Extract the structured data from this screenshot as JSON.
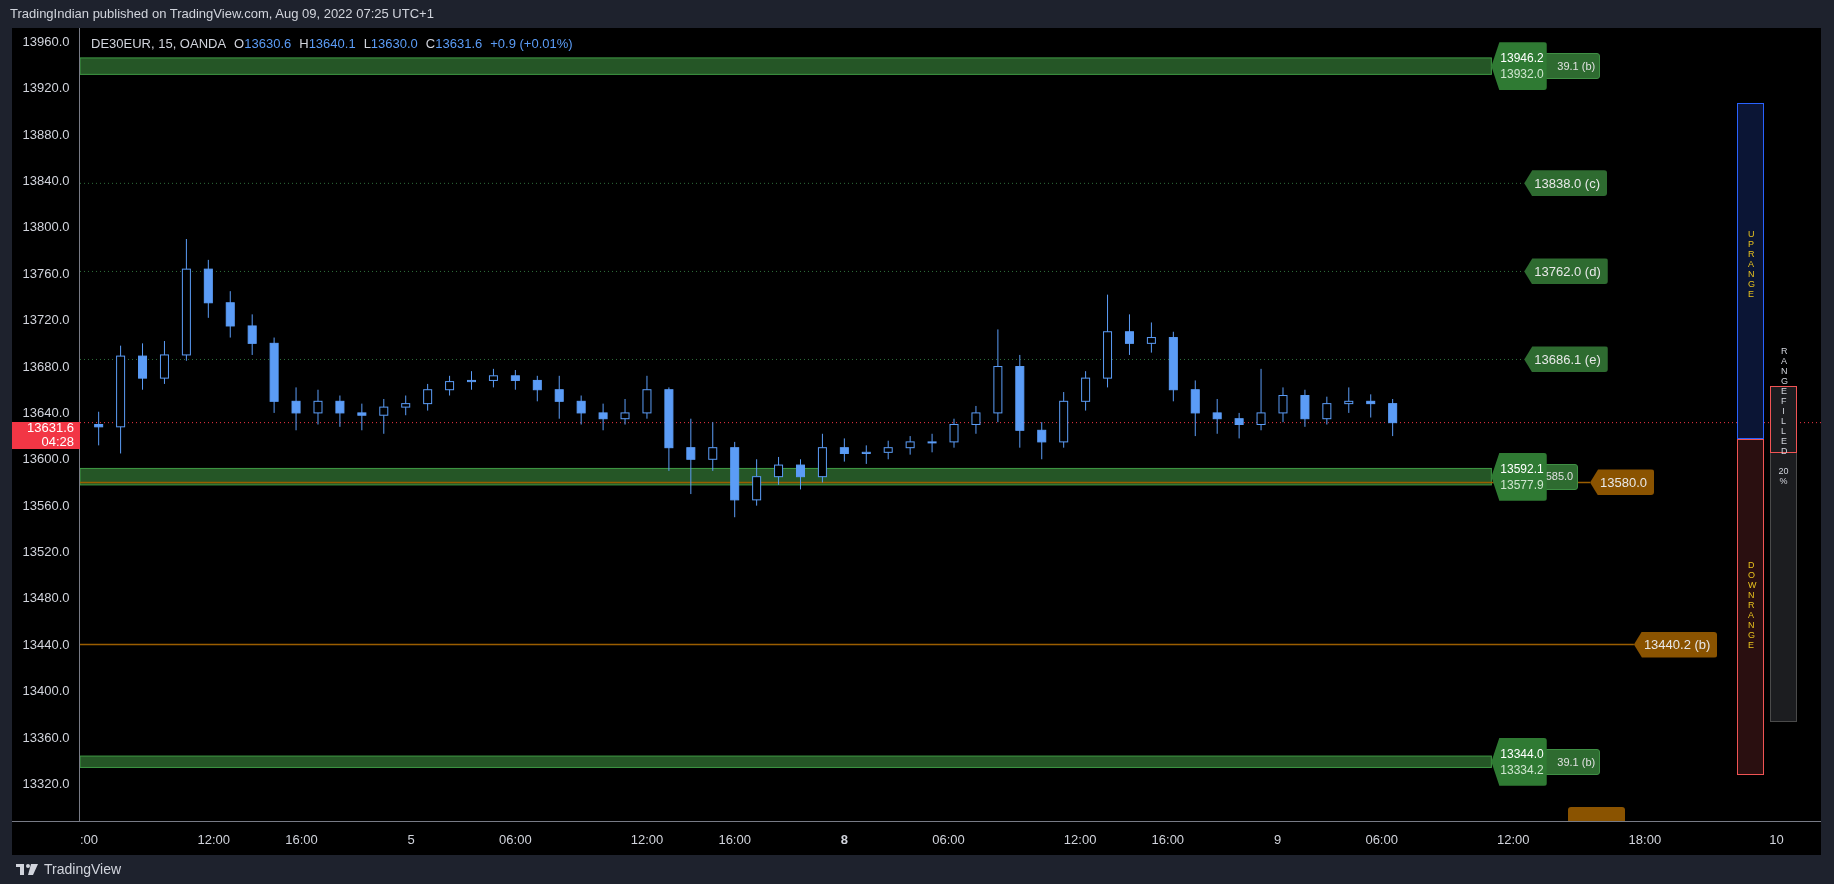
{
  "header": {
    "text": "TradingIndian published on TradingView.com, Aug 09, 2022 07:25 UTC+1"
  },
  "legend": {
    "symbol": "DE30EUR, 15, OANDA",
    "fields": [
      {
        "label": "O",
        "value": "13630.6"
      },
      {
        "label": "H",
        "value": "13640.1"
      },
      {
        "label": "L",
        "value": "13630.0"
      },
      {
        "label": "C",
        "value": "13631.6"
      }
    ],
    "change": "+0.9 (+0.01%)"
  },
  "chart": {
    "chart_data": {
      "type": "candlestick",
      "ohlc": [
        [
          13630,
          13641,
          13612,
          13628
        ],
        [
          13628,
          13698,
          13605,
          13689
        ],
        [
          13689,
          13700,
          13660,
          13670
        ],
        [
          13670,
          13702,
          13665,
          13690
        ],
        [
          13690,
          13790,
          13685,
          13764
        ],
        [
          13764,
          13772,
          13722,
          13735
        ],
        [
          13735,
          13745,
          13705,
          13715
        ],
        [
          13715,
          13725,
          13690,
          13700
        ],
        [
          13700,
          13705,
          13640,
          13650
        ],
        [
          13650,
          13662,
          13625,
          13640
        ],
        [
          13640,
          13660,
          13630,
          13650
        ],
        [
          13650,
          13655,
          13628,
          13640
        ],
        [
          13640,
          13648,
          13625,
          13638
        ],
        [
          13638,
          13652,
          13622,
          13645
        ],
        [
          13645,
          13655,
          13638,
          13648
        ],
        [
          13648,
          13665,
          13642,
          13660
        ],
        [
          13660,
          13672,
          13655,
          13667
        ],
        [
          13667,
          13676,
          13660,
          13668
        ],
        [
          13668,
          13678,
          13662,
          13672
        ],
        [
          13672,
          13677,
          13660,
          13668
        ],
        [
          13668,
          13672,
          13650,
          13660
        ],
        [
          13660,
          13672,
          13635,
          13650
        ],
        [
          13650,
          13655,
          13630,
          13640
        ],
        [
          13640,
          13648,
          13625,
          13635
        ],
        [
          13635,
          13652,
          13630,
          13640
        ],
        [
          13640,
          13672,
          13635,
          13660
        ],
        [
          13660,
          13662,
          13590,
          13610
        ],
        [
          13610,
          13635,
          13570,
          13600
        ],
        [
          13600,
          13632,
          13590,
          13610
        ],
        [
          13610,
          13615,
          13550,
          13565
        ],
        [
          13565,
          13600,
          13560,
          13585
        ],
        [
          13585,
          13602,
          13578,
          13595
        ],
        [
          13595,
          13600,
          13574,
          13585
        ],
        [
          13585,
          13622,
          13580,
          13610
        ],
        [
          13610,
          13618,
          13598,
          13605
        ],
        [
          13605,
          13612,
          13596,
          13606
        ],
        [
          13606,
          13616,
          13600,
          13610
        ],
        [
          13610,
          13620,
          13604,
          13615
        ],
        [
          13615,
          13622,
          13606,
          13615
        ],
        [
          13615,
          13635,
          13610,
          13630
        ],
        [
          13630,
          13646,
          13622,
          13640
        ],
        [
          13640,
          13712,
          13632,
          13680
        ],
        [
          13680,
          13690,
          13610,
          13625
        ],
        [
          13625,
          13632,
          13600,
          13615
        ],
        [
          13615,
          13658,
          13610,
          13650
        ],
        [
          13650,
          13676,
          13642,
          13670
        ],
        [
          13670,
          13742,
          13662,
          13710
        ],
        [
          13710,
          13725,
          13690,
          13700
        ],
        [
          13700,
          13718,
          13692,
          13705
        ],
        [
          13705,
          13710,
          13650,
          13660
        ],
        [
          13660,
          13668,
          13620,
          13640
        ],
        [
          13640,
          13652,
          13622,
          13635
        ],
        [
          13635,
          13640,
          13618,
          13630
        ],
        [
          13630,
          13678,
          13625,
          13640
        ],
        [
          13640,
          13662,
          13632,
          13655
        ],
        [
          13655,
          13660,
          13628,
          13635
        ],
        [
          13635,
          13654,
          13630,
          13648
        ],
        [
          13648,
          13662,
          13640,
          13650
        ],
        [
          13650,
          13656,
          13636,
          13648
        ],
        [
          13648,
          13652,
          13620,
          13631.6
        ]
      ],
      "ylim": [
        13288,
        13972
      ],
      "yticks": [
        {
          "value": 13960,
          "label": "13960.0"
        },
        {
          "value": 13920,
          "label": "13920.0"
        },
        {
          "value": 13880,
          "label": "13880.0"
        },
        {
          "value": 13840,
          "label": "13840.0"
        },
        {
          "value": 13800,
          "label": "13800.0"
        },
        {
          "value": 13760,
          "label": "13760.0"
        },
        {
          "value": 13720,
          "label": "13720.0"
        },
        {
          "value": 13680,
          "label": "13680.0"
        },
        {
          "value": 13640,
          "label": "13640.0"
        },
        {
          "value": 13600,
          "label": "13600.0"
        },
        {
          "value": 13560,
          "label": "13560.0"
        },
        {
          "value": 13520,
          "label": "13520.0"
        },
        {
          "value": 13480,
          "label": "13480.0"
        },
        {
          "value": 13440,
          "label": "13440.0"
        },
        {
          "value": 13400,
          "label": "13400.0"
        },
        {
          "value": 13360,
          "label": "13360.0"
        },
        {
          "value": 13320,
          "label": "13320.0"
        }
      ],
      "ref_lines": [
        {
          "axis": "y",
          "value": 13838.0,
          "label": "13838.0 (c)",
          "color": "#2e6b30"
        },
        {
          "axis": "y",
          "value": 13762.0,
          "label": "13762.0 (d)",
          "color": "#2e6b30"
        },
        {
          "axis": "y",
          "value": 13686.1,
          "label": "13686.1 (e)",
          "color": "#2e6b30"
        },
        {
          "axis": "y",
          "value": 13580.0,
          "label": "13580.0",
          "color": "#8a5300"
        },
        {
          "axis": "y",
          "value": 13440.2,
          "label": "13440.2 (b)",
          "color": "#8a5300"
        },
        {
          "axis": "y",
          "value": 13631.6,
          "label": "13631.6",
          "color": "#f23645"
        }
      ],
      "bands": [
        {
          "axis": "y",
          "from": 13932.0,
          "to": 13946.2
        },
        {
          "axis": "y",
          "from": 13577.9,
          "to": 13592.1
        },
        {
          "axis": "y",
          "from": 13334.2,
          "to": 13344.0
        }
      ]
    }
  },
  "zone_labels": [
    {
      "upper": "13946.2",
      "lower": "13932.0"
    },
    {
      "upper": "13592.1",
      "lower": "13577.9"
    },
    {
      "upper": "13344.0",
      "lower": "13334.2"
    }
  ],
  "partial_labels": [
    {
      "label": "39.1 (b)"
    },
    {
      "label": "585.0"
    },
    {
      "label": "39.1 (b)"
    }
  ],
  "time_axis": [
    {
      "label": ":00",
      "bold": false
    },
    {
      "label": "12:00",
      "bold": false
    },
    {
      "label": "16:00",
      "bold": false
    },
    {
      "label": "5",
      "bold": false
    },
    {
      "label": "06:00",
      "bold": false
    },
    {
      "label": "12:00",
      "bold": false
    },
    {
      "label": "16:00",
      "bold": false
    },
    {
      "label": "8",
      "bold": true
    },
    {
      "label": "06:00",
      "bold": false
    },
    {
      "label": "12:00",
      "bold": false
    },
    {
      "label": "16:00",
      "bold": false
    },
    {
      "label": "9",
      "bold": false
    },
    {
      "label": "06:00",
      "bold": false
    },
    {
      "label": "12:00",
      "bold": false
    },
    {
      "label": "18:00",
      "bold": false
    },
    {
      "label": "10",
      "bold": false
    }
  ],
  "current_price": {
    "countdown": "04:28"
  },
  "range_panel": {
    "up_label": "UP RANGE",
    "down_label": "DOWN RANGE",
    "filled_label": "RANGE FILLED",
    "filled_value": "20 %",
    "level": 0.2
  },
  "footer": {
    "brand": "TradingView"
  }
}
